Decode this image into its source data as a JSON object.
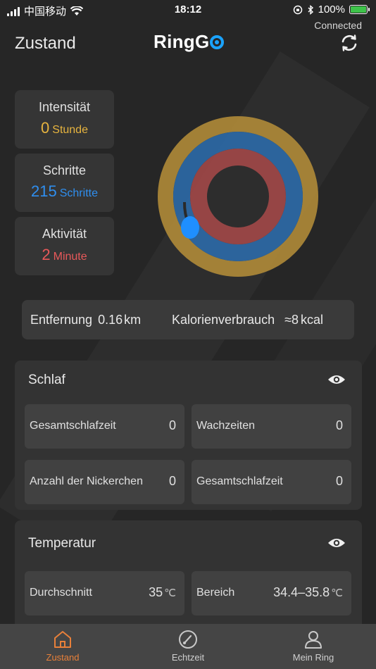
{
  "status_bar": {
    "carrier": "中国移动",
    "time": "18:12",
    "battery_percent": "100%"
  },
  "header": {
    "title": "Zustand",
    "logo_text": "RingG",
    "connection_status": "Connected"
  },
  "stats": [
    {
      "label": "Intensität",
      "value": "0",
      "unit": "Stunde",
      "color": "#e7b43f"
    },
    {
      "label": "Schritte",
      "value": "215",
      "unit": "Schritte",
      "color": "#2f8ff0"
    },
    {
      "label": "Aktivität",
      "value": "2",
      "unit": "Minute",
      "color": "#e8595a"
    }
  ],
  "activity_rings": {
    "colors": {
      "outer": "#b8913a",
      "middle": "#2c6aa8",
      "inner": "#a24848",
      "marker": "#1f8fff"
    }
  },
  "summary": {
    "distance_label": "Entfernung",
    "distance_value": "0.16",
    "distance_unit": "km",
    "calories_label": "Kalorienverbrauch",
    "calories_value": "≈8",
    "calories_unit": "kcal"
  },
  "sleep": {
    "title": "Schlaf",
    "cells": [
      {
        "label": "Gesamtschlafzeit",
        "value": "0"
      },
      {
        "label": "Wachzeiten",
        "value": "0"
      },
      {
        "label": "Anzahl der Nickerchen",
        "value": "0"
      },
      {
        "label": "Gesamtschlafzeit",
        "value": "0"
      }
    ]
  },
  "temperature": {
    "title": "Temperatur",
    "cells": [
      {
        "label": "Durchschnitt",
        "value": "35",
        "unit": "℃"
      },
      {
        "label": "Bereich",
        "value": "34.4–35.8",
        "unit": "℃"
      }
    ]
  },
  "tabs": [
    {
      "label": "Zustand",
      "icon": "home-icon",
      "active": true
    },
    {
      "label": "Echtzeit",
      "icon": "gauge-icon",
      "active": false
    },
    {
      "label": "Mein Ring",
      "icon": "person-icon",
      "active": false
    }
  ],
  "accent_color": "#e8803a"
}
